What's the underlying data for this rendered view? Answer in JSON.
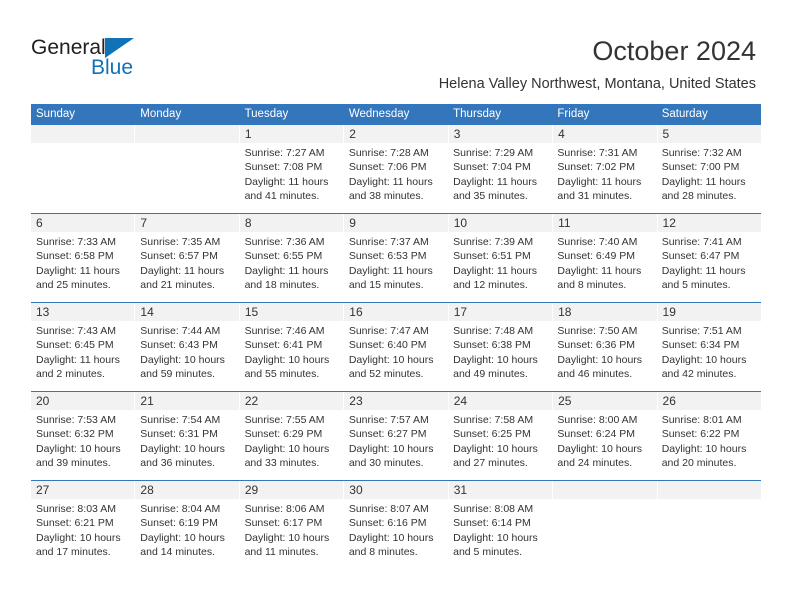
{
  "brand": {
    "name_dark": "General",
    "name_blue": "Blue",
    "flag_icon": "blue-triangle-flag-icon",
    "accent_color": "#1272b6"
  },
  "header": {
    "title": "October 2024",
    "subtitle": "Helena Valley Northwest, Montana, United States"
  },
  "theme": {
    "header_blue": "#3476bb",
    "date_band_gray": "#f2f2f2",
    "text_color": "#333333"
  },
  "calendar": {
    "day_names": [
      "Sunday",
      "Monday",
      "Tuesday",
      "Wednesday",
      "Thursday",
      "Friday",
      "Saturday"
    ],
    "weeks": [
      [
        {
          "day": "",
          "lines": []
        },
        {
          "day": "",
          "lines": []
        },
        {
          "day": "1",
          "lines": [
            "Sunrise: 7:27 AM",
            "Sunset: 7:08 PM",
            "Daylight: 11 hours",
            "and 41 minutes."
          ]
        },
        {
          "day": "2",
          "lines": [
            "Sunrise: 7:28 AM",
            "Sunset: 7:06 PM",
            "Daylight: 11 hours",
            "and 38 minutes."
          ]
        },
        {
          "day": "3",
          "lines": [
            "Sunrise: 7:29 AM",
            "Sunset: 7:04 PM",
            "Daylight: 11 hours",
            "and 35 minutes."
          ]
        },
        {
          "day": "4",
          "lines": [
            "Sunrise: 7:31 AM",
            "Sunset: 7:02 PM",
            "Daylight: 11 hours",
            "and 31 minutes."
          ]
        },
        {
          "day": "5",
          "lines": [
            "Sunrise: 7:32 AM",
            "Sunset: 7:00 PM",
            "Daylight: 11 hours",
            "and 28 minutes."
          ]
        }
      ],
      [
        {
          "day": "6",
          "lines": [
            "Sunrise: 7:33 AM",
            "Sunset: 6:58 PM",
            "Daylight: 11 hours",
            "and 25 minutes."
          ]
        },
        {
          "day": "7",
          "lines": [
            "Sunrise: 7:35 AM",
            "Sunset: 6:57 PM",
            "Daylight: 11 hours",
            "and 21 minutes."
          ]
        },
        {
          "day": "8",
          "lines": [
            "Sunrise: 7:36 AM",
            "Sunset: 6:55 PM",
            "Daylight: 11 hours",
            "and 18 minutes."
          ]
        },
        {
          "day": "9",
          "lines": [
            "Sunrise: 7:37 AM",
            "Sunset: 6:53 PM",
            "Daylight: 11 hours",
            "and 15 minutes."
          ]
        },
        {
          "day": "10",
          "lines": [
            "Sunrise: 7:39 AM",
            "Sunset: 6:51 PM",
            "Daylight: 11 hours",
            "and 12 minutes."
          ]
        },
        {
          "day": "11",
          "lines": [
            "Sunrise: 7:40 AM",
            "Sunset: 6:49 PM",
            "Daylight: 11 hours",
            "and 8 minutes."
          ]
        },
        {
          "day": "12",
          "lines": [
            "Sunrise: 7:41 AM",
            "Sunset: 6:47 PM",
            "Daylight: 11 hours",
            "and 5 minutes."
          ]
        }
      ],
      [
        {
          "day": "13",
          "lines": [
            "Sunrise: 7:43 AM",
            "Sunset: 6:45 PM",
            "Daylight: 11 hours",
            "and 2 minutes."
          ]
        },
        {
          "day": "14",
          "lines": [
            "Sunrise: 7:44 AM",
            "Sunset: 6:43 PM",
            "Daylight: 10 hours",
            "and 59 minutes."
          ]
        },
        {
          "day": "15",
          "lines": [
            "Sunrise: 7:46 AM",
            "Sunset: 6:41 PM",
            "Daylight: 10 hours",
            "and 55 minutes."
          ]
        },
        {
          "day": "16",
          "lines": [
            "Sunrise: 7:47 AM",
            "Sunset: 6:40 PM",
            "Daylight: 10 hours",
            "and 52 minutes."
          ]
        },
        {
          "day": "17",
          "lines": [
            "Sunrise: 7:48 AM",
            "Sunset: 6:38 PM",
            "Daylight: 10 hours",
            "and 49 minutes."
          ]
        },
        {
          "day": "18",
          "lines": [
            "Sunrise: 7:50 AM",
            "Sunset: 6:36 PM",
            "Daylight: 10 hours",
            "and 46 minutes."
          ]
        },
        {
          "day": "19",
          "lines": [
            "Sunrise: 7:51 AM",
            "Sunset: 6:34 PM",
            "Daylight: 10 hours",
            "and 42 minutes."
          ]
        }
      ],
      [
        {
          "day": "20",
          "lines": [
            "Sunrise: 7:53 AM",
            "Sunset: 6:32 PM",
            "Daylight: 10 hours",
            "and 39 minutes."
          ]
        },
        {
          "day": "21",
          "lines": [
            "Sunrise: 7:54 AM",
            "Sunset: 6:31 PM",
            "Daylight: 10 hours",
            "and 36 minutes."
          ]
        },
        {
          "day": "22",
          "lines": [
            "Sunrise: 7:55 AM",
            "Sunset: 6:29 PM",
            "Daylight: 10 hours",
            "and 33 minutes."
          ]
        },
        {
          "day": "23",
          "lines": [
            "Sunrise: 7:57 AM",
            "Sunset: 6:27 PM",
            "Daylight: 10 hours",
            "and 30 minutes."
          ]
        },
        {
          "day": "24",
          "lines": [
            "Sunrise: 7:58 AM",
            "Sunset: 6:25 PM",
            "Daylight: 10 hours",
            "and 27 minutes."
          ]
        },
        {
          "day": "25",
          "lines": [
            "Sunrise: 8:00 AM",
            "Sunset: 6:24 PM",
            "Daylight: 10 hours",
            "and 24 minutes."
          ]
        },
        {
          "day": "26",
          "lines": [
            "Sunrise: 8:01 AM",
            "Sunset: 6:22 PM",
            "Daylight: 10 hours",
            "and 20 minutes."
          ]
        }
      ],
      [
        {
          "day": "27",
          "lines": [
            "Sunrise: 8:03 AM",
            "Sunset: 6:21 PM",
            "Daylight: 10 hours",
            "and 17 minutes."
          ]
        },
        {
          "day": "28",
          "lines": [
            "Sunrise: 8:04 AM",
            "Sunset: 6:19 PM",
            "Daylight: 10 hours",
            "and 14 minutes."
          ]
        },
        {
          "day": "29",
          "lines": [
            "Sunrise: 8:06 AM",
            "Sunset: 6:17 PM",
            "Daylight: 10 hours",
            "and 11 minutes."
          ]
        },
        {
          "day": "30",
          "lines": [
            "Sunrise: 8:07 AM",
            "Sunset: 6:16 PM",
            "Daylight: 10 hours",
            "and 8 minutes."
          ]
        },
        {
          "day": "31",
          "lines": [
            "Sunrise: 8:08 AM",
            "Sunset: 6:14 PM",
            "Daylight: 10 hours",
            "and 5 minutes."
          ]
        },
        {
          "day": "",
          "lines": []
        },
        {
          "day": "",
          "lines": []
        }
      ]
    ]
  }
}
